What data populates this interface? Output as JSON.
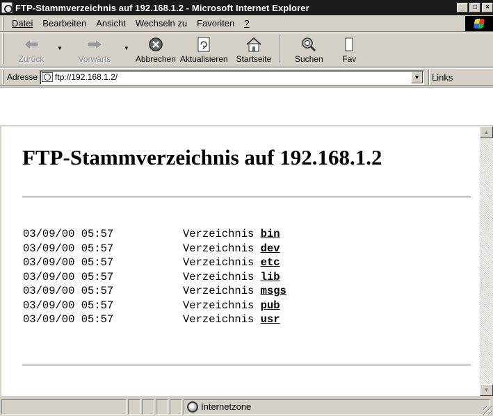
{
  "window": {
    "title": "FTP-Stammverzeichnis auf 192.168.1.2 - Microsoft Internet Explorer",
    "minimize": "_",
    "maximize": "□",
    "close": "×"
  },
  "menubar": {
    "items": [
      {
        "label": "Datei",
        "mnemonic": "D"
      },
      {
        "label": "Bearbeiten",
        "mnemonic": "B"
      },
      {
        "label": "Ansicht",
        "mnemonic": "A"
      },
      {
        "label": "Wechseln zu",
        "mnemonic": "W"
      },
      {
        "label": "Favoriten",
        "mnemonic": "F"
      },
      {
        "label": "?",
        "mnemonic": "?"
      }
    ]
  },
  "toolbar": {
    "back_label": "Zurück",
    "forward_label": "Vorwärts",
    "stop_label": "Abbrechen",
    "refresh_label": "Aktualisieren",
    "home_label": "Startseite",
    "search_label": "Suchen",
    "favorites_label": "Fav"
  },
  "address": {
    "label": "Adresse",
    "value": "ftp://192.168.1.2/",
    "links_label": "Links"
  },
  "page": {
    "heading": "FTP-Stammverzeichnis auf 192.168.1.2",
    "entries": [
      {
        "datetime": "03/09/00 05:57",
        "type": "Verzeichnis",
        "name": "bin"
      },
      {
        "datetime": "03/09/00 05:57",
        "type": "Verzeichnis",
        "name": "dev"
      },
      {
        "datetime": "03/09/00 05:57",
        "type": "Verzeichnis",
        "name": "etc"
      },
      {
        "datetime": "03/09/00 05:57",
        "type": "Verzeichnis",
        "name": "lib"
      },
      {
        "datetime": "03/09/00 05:57",
        "type": "Verzeichnis",
        "name": "msgs"
      },
      {
        "datetime": "03/09/00 05:57",
        "type": "Verzeichnis",
        "name": "pub"
      },
      {
        "datetime": "03/09/00 05:57",
        "type": "Verzeichnis",
        "name": "usr"
      }
    ]
  },
  "statusbar": {
    "zone": "Internetzone"
  }
}
